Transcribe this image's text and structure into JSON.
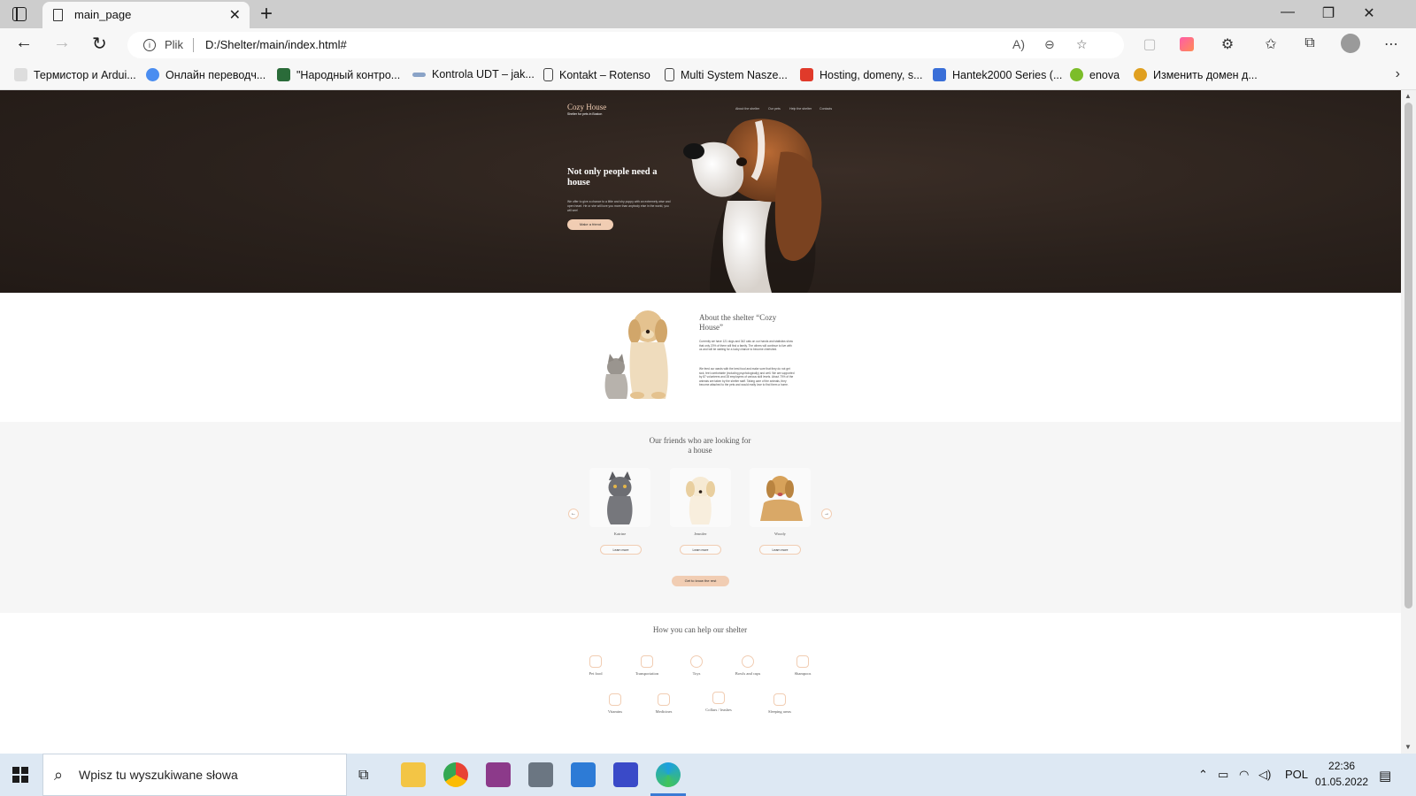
{
  "browser": {
    "tab_title": "main_page",
    "address_prefix": "Plik",
    "url": "D:/Shelter/main/index.html#",
    "bookmarks": [
      "Термистор и Ardui...",
      "Онлайн переводч...",
      "\"Народный контро...",
      "Kontrola UDT – jak...",
      "Kontakt – Rotenso",
      "Multi System Nasze...",
      "Hosting, domeny, s...",
      "Hantek2000 Series (...",
      "enova",
      "Изменить домен д..."
    ]
  },
  "page": {
    "logo": "Cozy House",
    "logo_sub": "Shelter for pets in Boston",
    "menu": [
      "About the shelter",
      "Our pets",
      "Help the shelter",
      "Contacts"
    ],
    "hero_title": "Not only people need a house",
    "hero_text": "We offer to give a chance to a little and shy puppy with an extremely wise and open heart. He or she will love you more than anybody else in the world, you will see!",
    "hero_button": "Make a friend",
    "about_title": "About the shelter “Cozy House”",
    "about_p1": "Currently we have 121 dogs and 342 cats on our hands and statistics show that only 20% of them will find a family. The others will continue to live with us and will be waiting for a lucky chance to become cherished.",
    "about_p2": "We feed our wards with the best food and make sure that they do not get sick, feel comfortable (including psychologically) and well. We are supported by 87 volunteers and 28 employees of various skill levels. About 70% of the animals are taken by the shelter staff. Taking care of the animals, they become attached to the pets and would really love to find them a home.",
    "friends_title": "Our friends who are looking for a house",
    "pets": [
      {
        "name": "Katrine",
        "button": "Learn more"
      },
      {
        "name": "Jennifer",
        "button": "Learn more"
      },
      {
        "name": "Woody",
        "button": "Learn more"
      }
    ],
    "friends_button": "Get to know the rest",
    "help_title": "How you can help our shelter",
    "help_row1": [
      "Pet food",
      "Transportation",
      "Toys",
      "Bowls and cups",
      "Shampoos"
    ],
    "help_row2": [
      "Vitamins",
      "Medicines",
      "Collars / leashes",
      "Sleeping areas"
    ]
  },
  "taskbar": {
    "search_placeholder": "Wpisz tu wyszukiwane słowa",
    "language": "POL",
    "time": "22:36",
    "date": "01.05.2022"
  },
  "colors": {
    "accent": "#f1cdb3",
    "hero_bg": "#2a211c",
    "friends_bg": "#f6f6f6"
  }
}
